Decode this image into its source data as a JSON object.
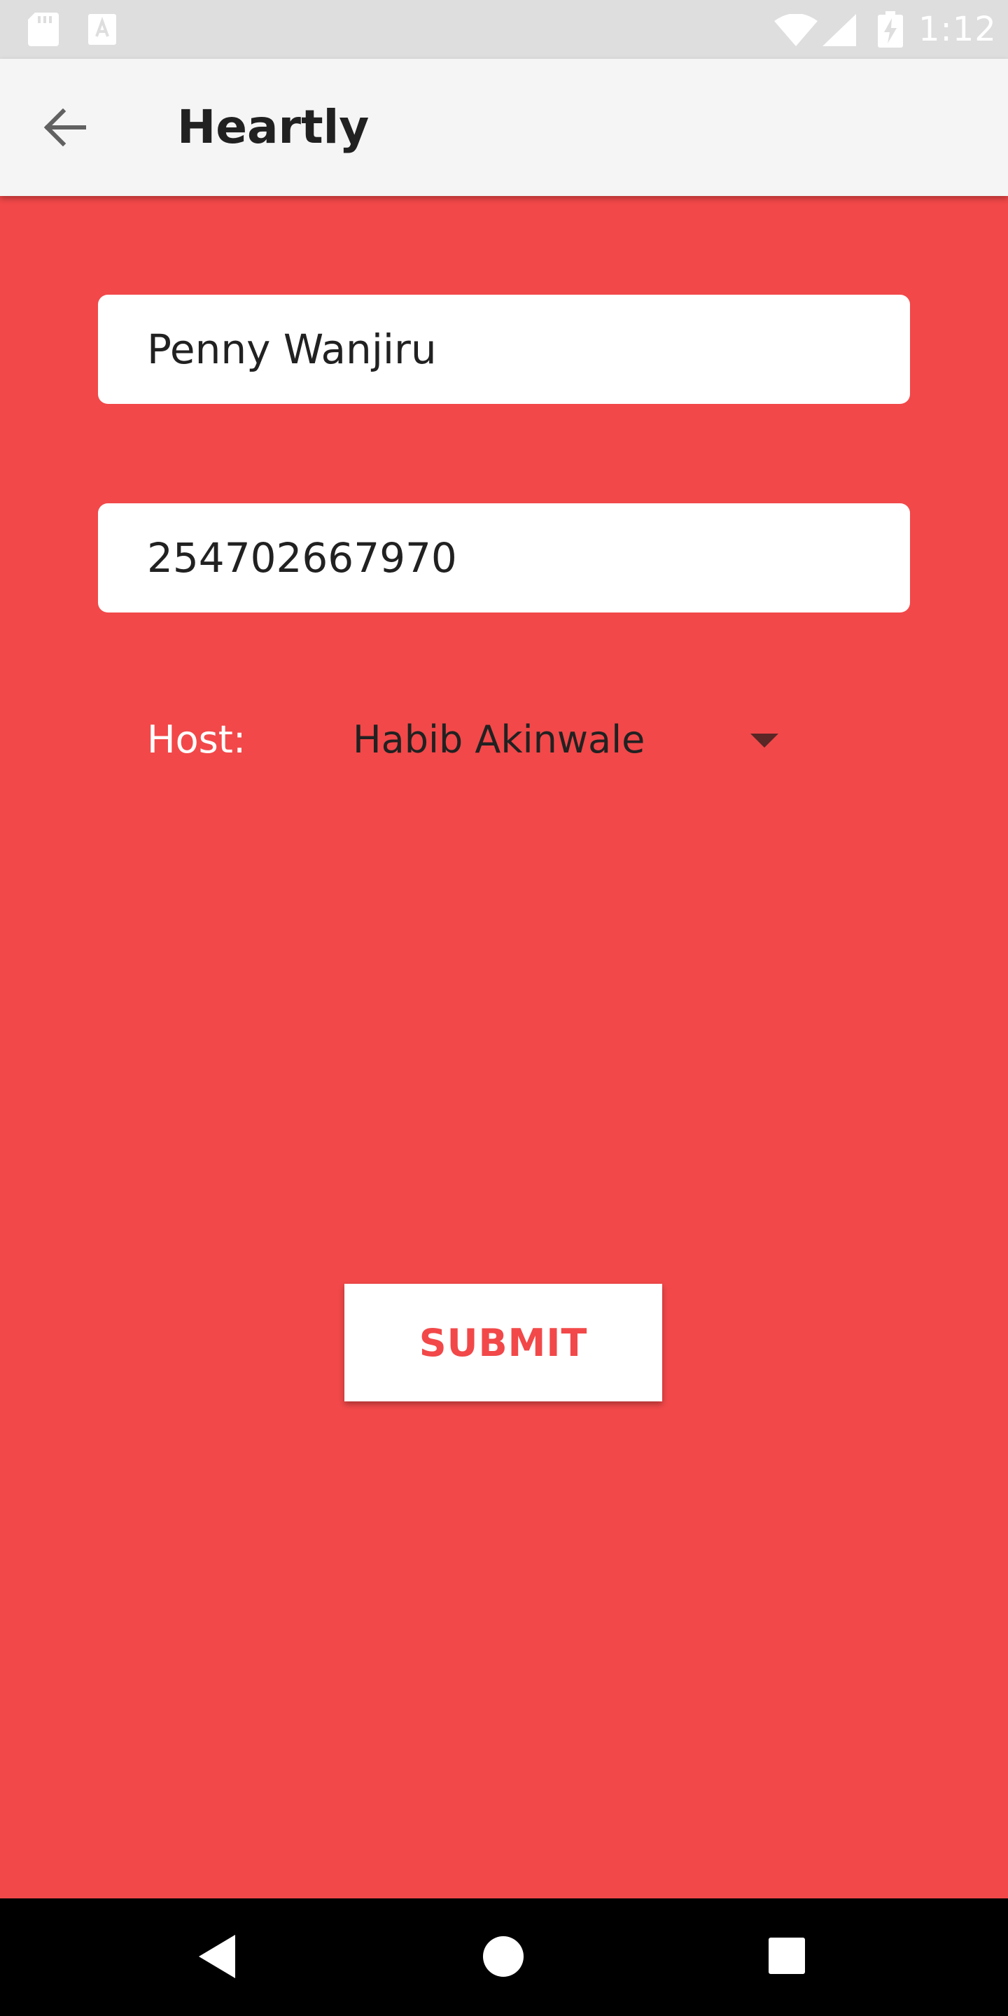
{
  "status_bar": {
    "time": "1:12",
    "icons": [
      "sd-card-icon",
      "a-notification-icon",
      "wifi-icon",
      "cell-signal-icon",
      "battery-charging-icon"
    ]
  },
  "app_bar": {
    "title": "Heartly",
    "back_icon": "arrow-left-icon"
  },
  "form": {
    "name_value": "Penny Wanjiru",
    "phone_value": "254702667970",
    "host_label": "Host:",
    "host_selected": "Habib Akinwale",
    "submit_label": "SUBMIT"
  },
  "nav_bar": {
    "icons": [
      "nav-back-icon",
      "nav-home-icon",
      "nav-recents-icon"
    ]
  },
  "colors": {
    "background": "#F24849",
    "app_bar": "#F5F5F5",
    "status_bar": "#DEDEDE",
    "field": "#FFFFFF",
    "accent_text": "#F24849",
    "nav_bar": "#000000"
  }
}
